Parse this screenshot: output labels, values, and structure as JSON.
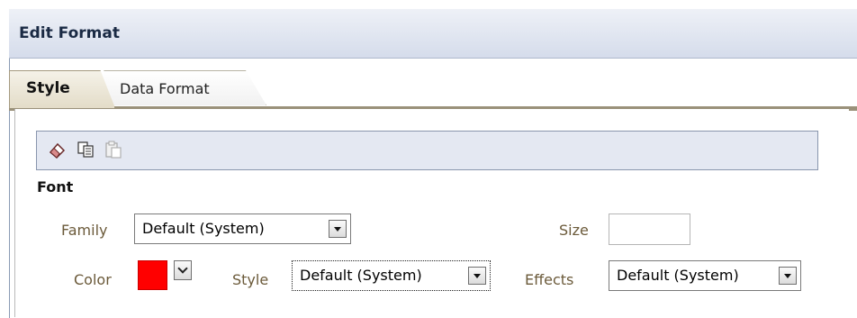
{
  "dialog": {
    "title": "Edit Format"
  },
  "tabs": [
    {
      "label": "Style",
      "selected": true
    },
    {
      "label": "Data Format",
      "selected": false
    }
  ],
  "toolbar": {
    "icons": [
      "eraser-icon",
      "copy-icon",
      "paste-icon"
    ]
  },
  "font": {
    "section_label": "Font",
    "family": {
      "label": "Family",
      "value": "Default (System)"
    },
    "size": {
      "label": "Size",
      "value": ""
    },
    "color": {
      "label": "Color",
      "value": "#ff0000"
    },
    "style": {
      "label": "Style",
      "value": "Default (System)"
    },
    "effects": {
      "label": "Effects",
      "value": "Default (System)"
    }
  }
}
